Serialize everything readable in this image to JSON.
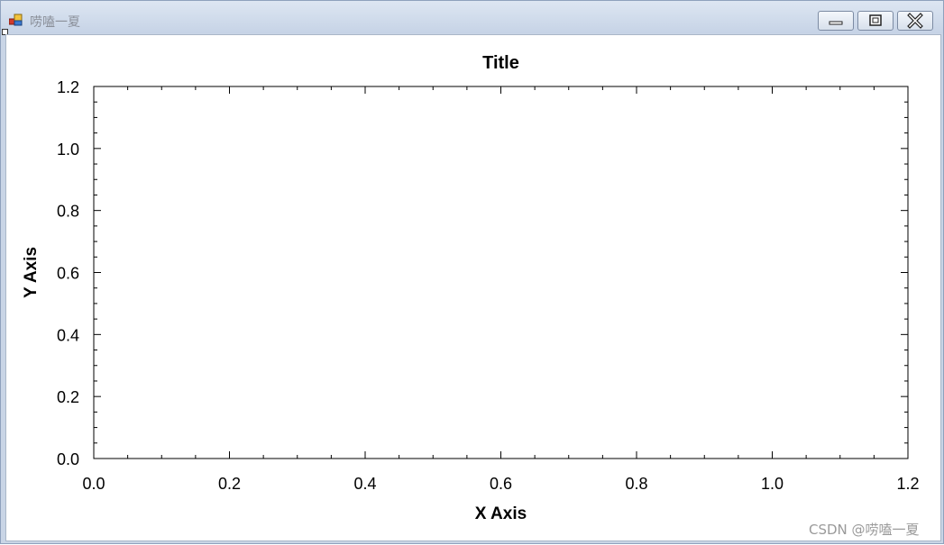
{
  "window": {
    "title": "唠嗑一夏",
    "icon": "winforms-app-icon",
    "buttons": [
      "minimize-icon",
      "maximize-icon",
      "close-icon"
    ]
  },
  "chart_data": {
    "type": "scatter",
    "title": "Title",
    "xlabel": "X Axis",
    "ylabel": "Y Axis",
    "xlim": [
      0,
      1.2
    ],
    "ylim": [
      0,
      1.2
    ],
    "x_ticks": [
      "0.0",
      "0.2",
      "0.4",
      "0.6",
      "0.8",
      "1.0",
      "1.2"
    ],
    "y_ticks": [
      "0.0",
      "0.2",
      "0.4",
      "0.6",
      "0.8",
      "1.0",
      "1.2"
    ],
    "series": [],
    "grid": false,
    "legend": "none"
  },
  "watermark": "CSDN @唠嗑一夏"
}
